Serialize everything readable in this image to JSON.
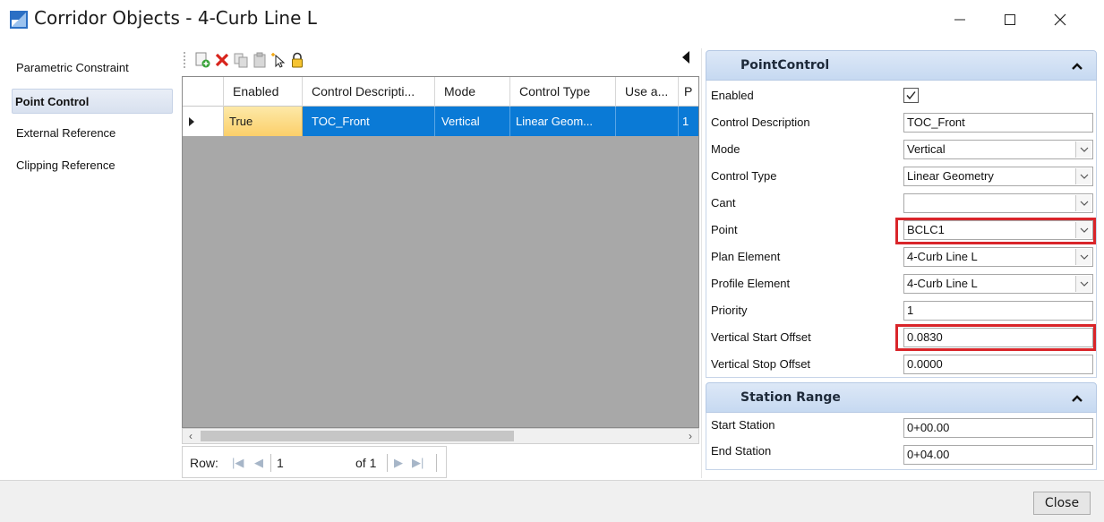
{
  "window": {
    "title": "Corridor Objects - 4-Curb Line L",
    "minimize_glyph": "—",
    "maximize_glyph": "☐",
    "close_glyph": "✕"
  },
  "leftnav": {
    "items": [
      {
        "label": "Parametric Constraint",
        "selected": false
      },
      {
        "label": "Point Control",
        "selected": true
      },
      {
        "label": "External Reference",
        "selected": false
      },
      {
        "label": "Clipping Reference",
        "selected": false
      }
    ]
  },
  "toolbar": {
    "icons": [
      "add-row-icon",
      "delete-icon",
      "copy-icon",
      "paste-icon",
      "select-cursor-icon",
      "lock-icon"
    ]
  },
  "grid": {
    "columns": [
      "Enabled",
      "Control Descripti...",
      "Mode",
      "Control Type",
      "Use a...",
      "P"
    ],
    "rows": [
      {
        "enabled": "True",
        "control_description": "TOC_Front",
        "mode": "Vertical",
        "control_type": "Linear Geom...",
        "use_a": "",
        "p": "1"
      }
    ]
  },
  "navigator": {
    "row_label": "Row:",
    "current": "1",
    "of_label": "of 1"
  },
  "point_control": {
    "header": "PointControl",
    "enabled_label": "Enabled",
    "enabled_checked": true,
    "control_description_label": "Control Description",
    "control_description_value": "TOC_Front",
    "mode_label": "Mode",
    "mode_value": "Vertical",
    "control_type_label": "Control Type",
    "control_type_value": "Linear Geometry",
    "cant_label": "Cant",
    "cant_value": "",
    "point_label": "Point",
    "point_value": "BCLC1",
    "plan_element_label": "Plan Element",
    "plan_element_value": "4-Curb Line L",
    "profile_element_label": "Profile Element",
    "profile_element_value": "4-Curb Line L",
    "priority_label": "Priority",
    "priority_value": "1",
    "vertical_start_offset_label": "Vertical Start Offset",
    "vertical_start_offset_value": "0.0830",
    "vertical_stop_offset_label": "Vertical Stop Offset",
    "vertical_stop_offset_value": "0.0000"
  },
  "station_range": {
    "header": "Station Range",
    "start_station_label": "Start Station",
    "start_station_value": "0+00.00",
    "end_station_label": "End Station",
    "end_station_value": "0+04.00"
  },
  "footer": {
    "close_label": "Close"
  },
  "colors": {
    "selection_blue": "#0a7ad6",
    "highlight_red": "#d9252a",
    "current_cell_gold": "#fbcf6a"
  }
}
